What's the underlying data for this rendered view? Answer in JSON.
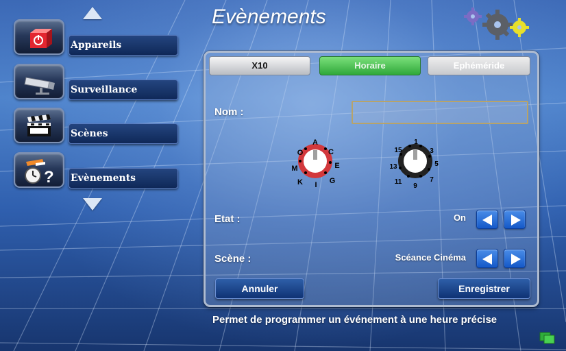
{
  "page": {
    "title": "Evènements"
  },
  "sidebar": {
    "items": [
      {
        "label": "Appareils",
        "icon": "power-box-icon"
      },
      {
        "label": "Surveillance",
        "icon": "camera-icon"
      },
      {
        "label": "Scènes",
        "icon": "clapperboard-icon"
      },
      {
        "label": "Evènements",
        "icon": "alarm-clock-question-icon"
      }
    ]
  },
  "tabs": [
    {
      "label": "X10",
      "state": "normal"
    },
    {
      "label": "Horaire",
      "state": "active"
    },
    {
      "label": "Ephéméride",
      "state": "disabled"
    }
  ],
  "form": {
    "nom_label": "Nom :",
    "nom_value": "",
    "etat_label": "Etat :",
    "etat_value": "On",
    "scene_label": "Scène :",
    "scene_value": "Scéance Cinéma",
    "cancel_label": "Annuler",
    "save_label": "Enregistrer"
  },
  "dials": {
    "letter": {
      "labels": [
        "A",
        "C",
        "E",
        "G",
        "I",
        "K",
        "M",
        "O"
      ],
      "ring_color": "#d2383c"
    },
    "number": {
      "labels": [
        "1",
        "3",
        "5",
        "7",
        "9",
        "11",
        "13",
        "15"
      ],
      "ring_color": "#222222"
    }
  },
  "footer": {
    "hint": "Permet de programmer un événement à une heure précise"
  },
  "colors": {
    "active_tab": "#3fbf47",
    "button": "#1a4b9a",
    "panel_border": "#aebbd0"
  }
}
